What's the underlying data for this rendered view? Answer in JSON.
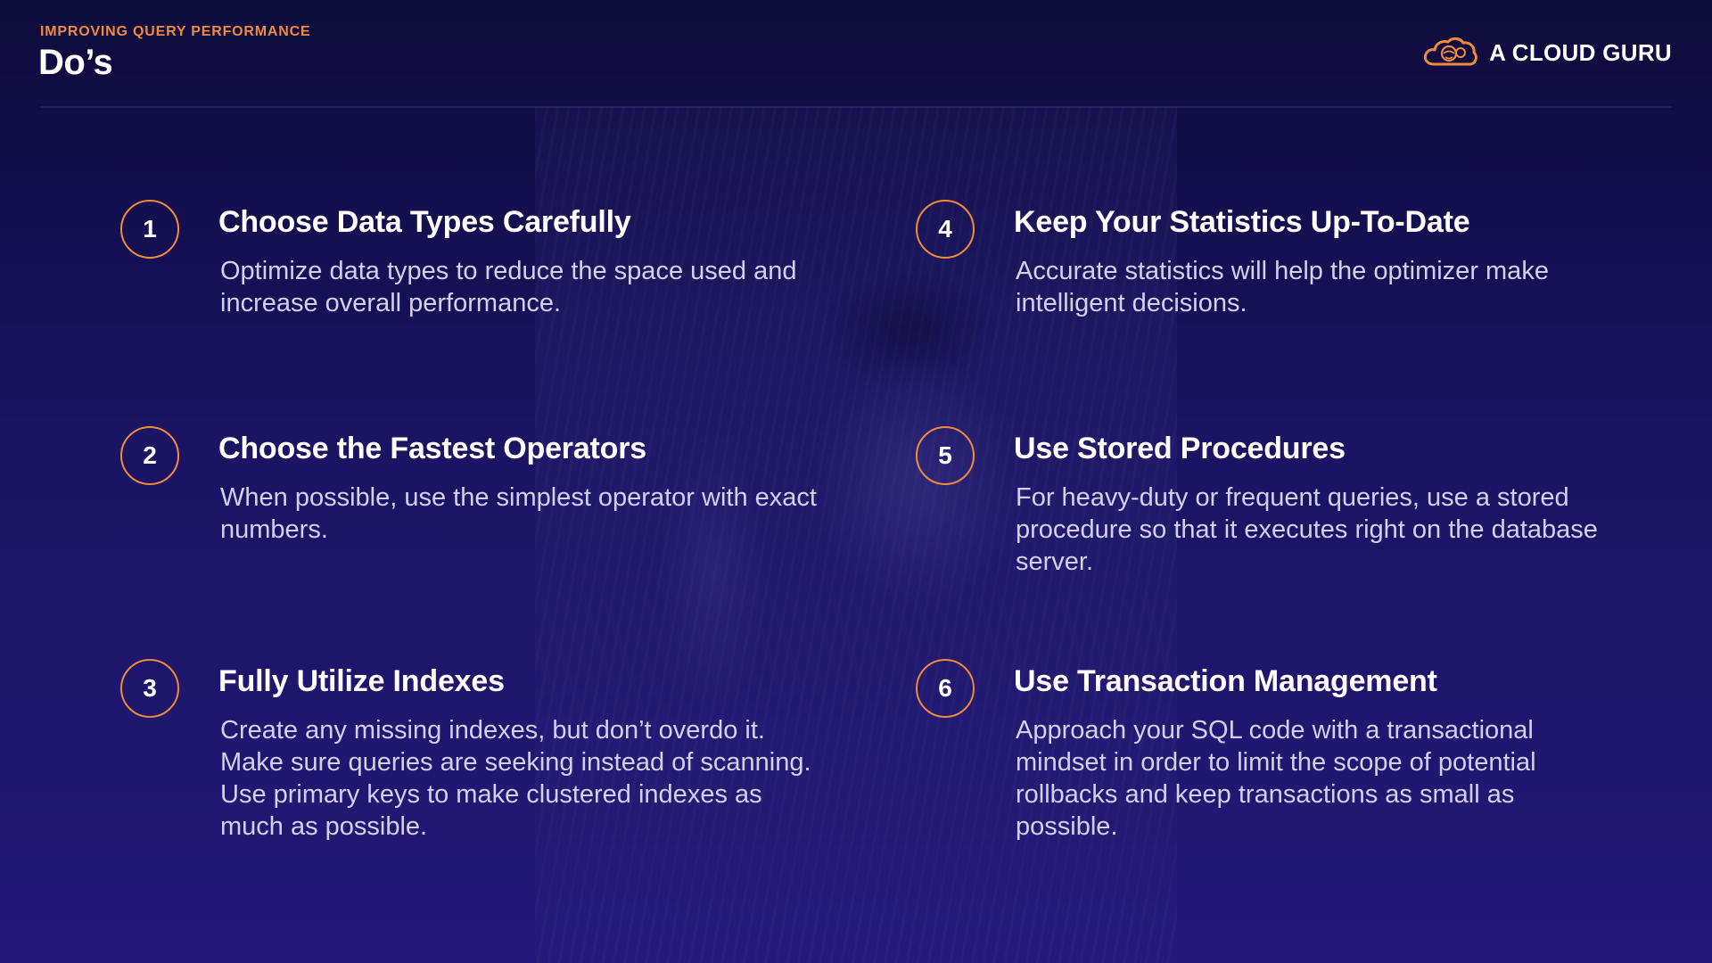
{
  "header": {
    "eyebrow": "IMPROVING QUERY PERFORMANCE",
    "title": "Do’s"
  },
  "logo": {
    "text": "A CLOUD GURU",
    "icon": "cloud-guru-icon",
    "icon_color": "#f08a3c"
  },
  "colors": {
    "accent": "#f08a3c",
    "background": "#1a1462",
    "text": "#ffffff",
    "muted_text": "#d3d0ea"
  },
  "items": [
    {
      "number": "1",
      "title": "Choose Data Types Carefully",
      "description": "Optimize data types to reduce the space used and increase overall performance."
    },
    {
      "number": "2",
      "title": "Choose the Fastest Operators",
      "description": "When possible, use the simplest operator with exact numbers."
    },
    {
      "number": "3",
      "title": "Fully Utilize Indexes",
      "description": "Create any missing indexes, but don’t overdo it. Make sure queries are seeking instead of scanning. Use primary keys to make clustered indexes as much as possible."
    },
    {
      "number": "4",
      "title": "Keep Your Statistics Up-To-Date",
      "description": "Accurate statistics will help the optimizer make intelligent decisions."
    },
    {
      "number": "5",
      "title": "Use Stored Procedures",
      "description": "For heavy-duty or frequent queries, use a stored procedure so that it executes right on the database server."
    },
    {
      "number": "6",
      "title": "Use Transaction Management",
      "description": "Approach your SQL code with a transactional mindset in order to limit the scope of potential rollbacks and keep transactions as small as possible."
    }
  ]
}
